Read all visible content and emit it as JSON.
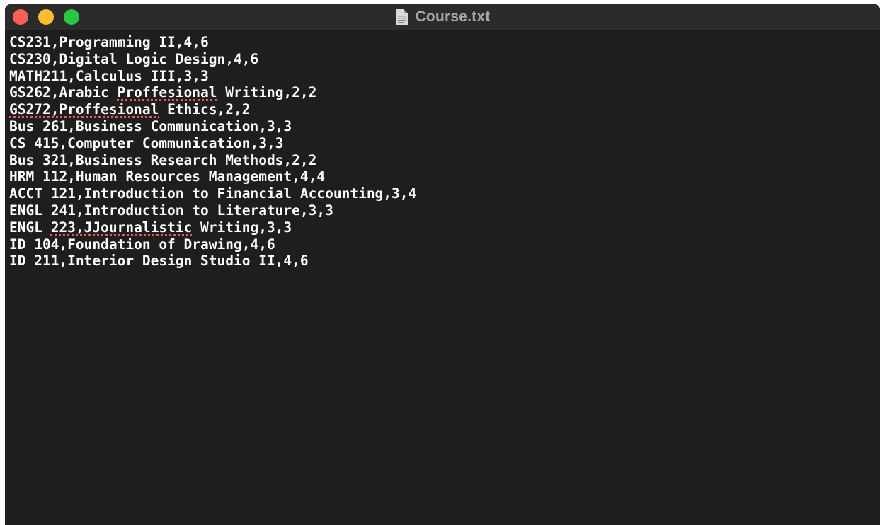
{
  "window": {
    "title": "Course.txt",
    "icons": {
      "file": "document-icon",
      "close": "close-light",
      "minimize": "minimize-light",
      "zoom": "zoom-light"
    },
    "colors": {
      "background": "#1e1e1e",
      "titlebar": "#2b2b2b",
      "text": "#ffffff",
      "title": "#a7a7a7",
      "spellcheck": "#e25b5b",
      "close": "#ff5f57",
      "minimize": "#febc2e",
      "zoom": "#28c840"
    }
  },
  "lines": [
    {
      "segments": [
        {
          "text": "CS231,Programming II,4,6"
        }
      ]
    },
    {
      "segments": [
        {
          "text": "CS230,Digital Logic Design,4,6"
        }
      ]
    },
    {
      "segments": [
        {
          "text": "MATH211,Calculus III,3,3"
        }
      ]
    },
    {
      "segments": [
        {
          "text": "GS262,Arabic "
        },
        {
          "text": "Proffesional",
          "misspelled": true
        },
        {
          "text": " Writing,2,2"
        }
      ]
    },
    {
      "segments": [
        {
          "text": "GS272,Proffesional",
          "misspelled": true
        },
        {
          "text": " Ethics,2,2"
        }
      ]
    },
    {
      "segments": [
        {
          "text": "Bus 261,Business Communication,3,3"
        }
      ]
    },
    {
      "segments": [
        {
          "text": "CS 415,Computer Communication,3,3"
        }
      ]
    },
    {
      "segments": [
        {
          "text": "Bus 321,Business Research Methods,2,2"
        }
      ]
    },
    {
      "segments": [
        {
          "text": "HRM 112,Human Resources Management,4,4"
        }
      ]
    },
    {
      "segments": [
        {
          "text": "ACCT 121,Introduction to Financial Accounting,3,4"
        }
      ]
    },
    {
      "segments": [
        {
          "text": "ENGL 241,Introduction to Literature,3,3"
        }
      ]
    },
    {
      "segments": [
        {
          "text": "ENGL "
        },
        {
          "text": "223,JJournalistic",
          "misspelled": true
        },
        {
          "text": " Writing,3,3"
        }
      ]
    },
    {
      "segments": [
        {
          "text": "ID 104,Foundation of Drawing,4,6"
        }
      ]
    },
    {
      "segments": [
        {
          "text": "ID 211,Interior Design Studio II,4,6"
        }
      ]
    }
  ]
}
